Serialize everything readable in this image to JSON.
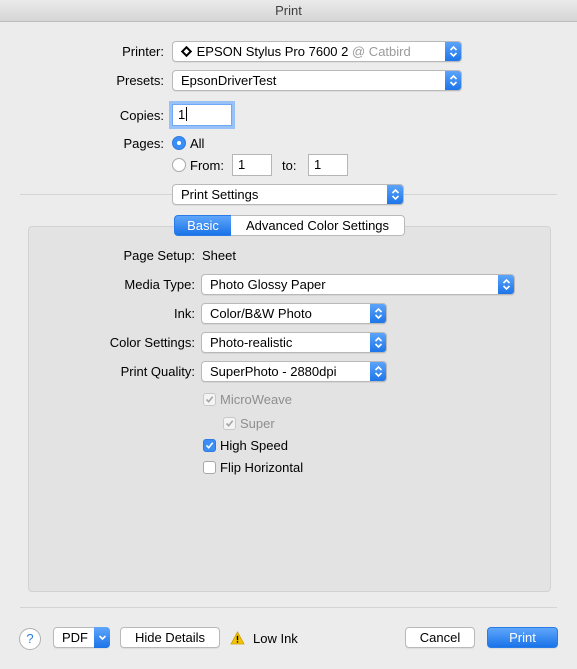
{
  "window": {
    "title": "Print"
  },
  "printer": {
    "label": "Printer:",
    "name": "EPSON Stylus Pro 7600 2",
    "location": "@ Catbird",
    "icon": "printer-bonjour-icon"
  },
  "presets": {
    "label": "Presets:",
    "value": "EpsonDriverTest"
  },
  "copies": {
    "label": "Copies:",
    "value": "1"
  },
  "pages": {
    "label": "Pages:",
    "all_label": "All",
    "from_label": "From:",
    "from_value": "1",
    "to_label": "to:",
    "to_value": "1",
    "selected": "All"
  },
  "section": {
    "value": "Print Settings"
  },
  "tabs": [
    {
      "label": "Basic",
      "selected": true
    },
    {
      "label": "Advanced Color Settings",
      "selected": false
    }
  ],
  "settings": {
    "page_setup_label": "Page Setup:",
    "page_setup_value": "Sheet",
    "media_type_label": "Media Type:",
    "media_type_value": "Photo Glossy Paper",
    "ink_label": "Ink:",
    "ink_value": "Color/B&W Photo",
    "color_settings_label": "Color Settings:",
    "color_settings_value": "Photo-realistic",
    "print_quality_label": "Print Quality:",
    "print_quality_value": "SuperPhoto - 2880dpi"
  },
  "options": {
    "microweave": {
      "label": "MicroWeave",
      "checked": true,
      "enabled": false
    },
    "super": {
      "label": "Super",
      "checked": true,
      "enabled": false
    },
    "high_speed": {
      "label": "High Speed",
      "checked": true,
      "enabled": true
    },
    "flip_horizontal": {
      "label": "Flip Horizontal",
      "checked": false,
      "enabled": true
    }
  },
  "footer": {
    "help_label": "?",
    "pdf_label": "PDF",
    "hide_details_label": "Hide Details",
    "warning_label": "Low Ink",
    "cancel_label": "Cancel",
    "print_label": "Print"
  },
  "colors": {
    "accent": "#1a73e8",
    "warning": "#f5c400"
  }
}
